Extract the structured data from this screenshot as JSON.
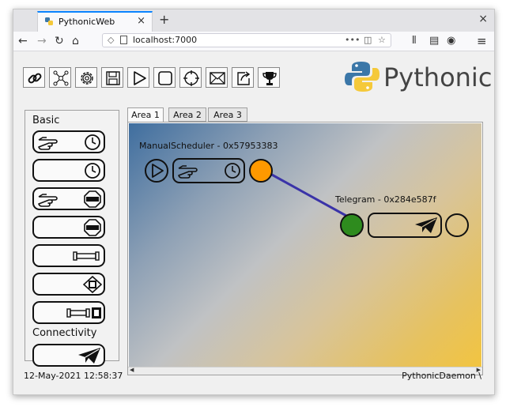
{
  "browser": {
    "tab_title": "PythonicWeb",
    "tab_close": "×",
    "new_tab": "+",
    "window_close": "×",
    "nav": {
      "back": "←",
      "forward": "→",
      "reload": "↻",
      "home": "⌂"
    },
    "url": "localhost:7000",
    "url_actions": {
      "more": "•••",
      "pocket": "◫",
      "bookmark": "☆"
    },
    "right_icons": {
      "library": "⫴",
      "sidebar": "▤",
      "account": "◉",
      "menu": "≡"
    }
  },
  "toolbar": {
    "icons": [
      "link-icon",
      "network-icon",
      "gear-icon",
      "save-icon",
      "play-icon",
      "stop-icon",
      "target-icon",
      "mail-icon",
      "export-icon",
      "trophy-icon"
    ]
  },
  "logo": {
    "text": "Pythonic"
  },
  "sidebar": {
    "sections": {
      "basic": "Basic",
      "connectivity": "Connectivity"
    },
    "basic_elements": [
      {
        "name": "manual-scheduler",
        "icons": [
          "hand-pointer-icon",
          "clock-icon"
        ]
      },
      {
        "name": "scheduler",
        "icons": [
          "clock-icon"
        ]
      },
      {
        "name": "manual-stop",
        "icons": [
          "hand-pointer-icon",
          "stop-sign-icon"
        ]
      },
      {
        "name": "stop",
        "icons": [
          "stop-sign-icon"
        ]
      },
      {
        "name": "generic-pipe",
        "icons": [
          "pipe-icon"
        ]
      },
      {
        "name": "processor",
        "icons": [
          "chip-icon"
        ]
      },
      {
        "name": "pipe-processor",
        "icons": [
          "pipe-icon",
          "chip-icon"
        ]
      }
    ],
    "connectivity_elements": [
      {
        "name": "telegram",
        "icons": [
          "paper-plane-icon"
        ]
      }
    ]
  },
  "area_tabs": [
    "Area 1",
    "Area 2",
    "Area 3"
  ],
  "active_area": "Area 1",
  "canvas": {
    "scheduler_label": "ManualScheduler - 0x57953383",
    "telegram_label": "Telegram - 0x284e587f",
    "colors": {
      "output_socket": "#ff9900",
      "input_socket": "#2e8b1e",
      "connection": "#3a33a8"
    }
  },
  "statusbar": {
    "datetime": "12-May-2021 12:58:37",
    "daemon": "PythonicDaemon \\"
  }
}
